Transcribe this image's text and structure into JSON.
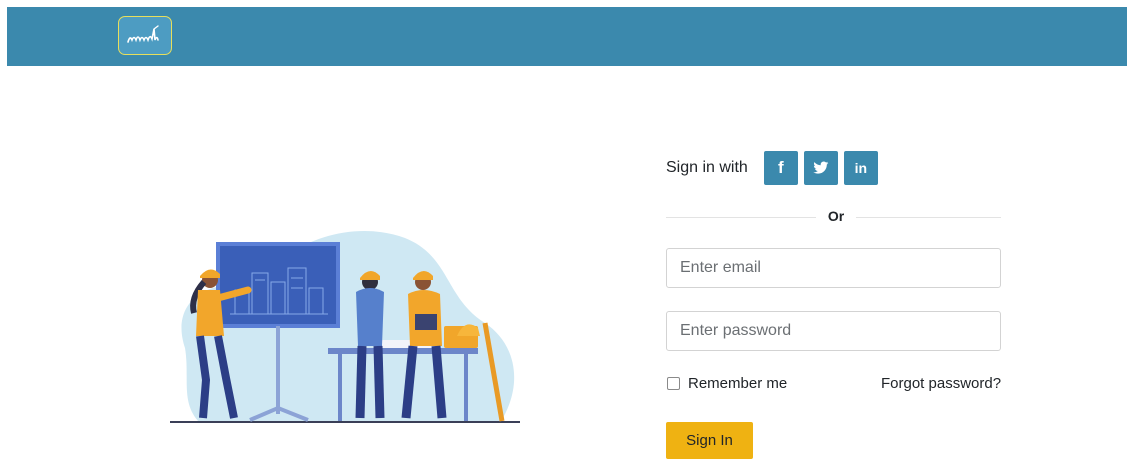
{
  "header": {
    "brand_color": "#3b89ad",
    "logo_accent": "#e7df5c"
  },
  "login": {
    "sign_in_with": "Sign in with",
    "social": [
      {
        "icon": "facebook-icon",
        "glyph": "f"
      },
      {
        "icon": "twitter-icon",
        "glyph": "twitter-bird"
      },
      {
        "icon": "linkedin-icon",
        "glyph": "in"
      }
    ],
    "or_label": "Or",
    "email_placeholder": "Enter email",
    "password_placeholder": "Enter password",
    "remember_label": "Remember me",
    "forgot_label": "Forgot password?",
    "submit_label": "Sign In",
    "submit_color": "#efb212"
  }
}
